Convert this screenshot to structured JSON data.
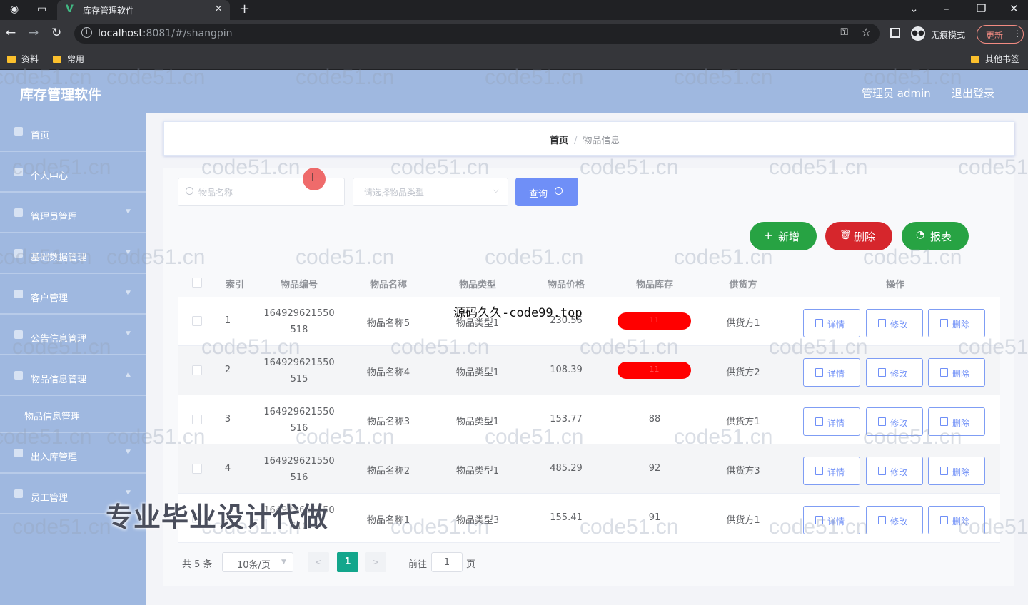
{
  "browser": {
    "tab_title": "库存管理软件",
    "url_host": "localhost",
    "url_rest": ":8081/#/shangpin",
    "incognito_label": "无痕模式",
    "update_label": "更新",
    "bookmarks": [
      "资料",
      "常用"
    ],
    "other_bookmarks": "其他书签"
  },
  "header": {
    "app_title": "库存管理软件",
    "user": "管理员 admin",
    "logout": "退出登录"
  },
  "sidebar": {
    "items": [
      "首页",
      "个人中心",
      "管理员管理",
      "基础数据管理",
      "客户管理",
      "公告信息管理",
      "物品信息管理",
      "出入库管理",
      "员工管理"
    ],
    "sub_item": "物品信息管理"
  },
  "breadcrumb": {
    "home": "首页",
    "separator": "/",
    "current": "物品信息"
  },
  "search": {
    "name_placeholder": "物品名称",
    "type_placeholder": "请选择物品类型",
    "query_label": "查询"
  },
  "actions": {
    "add": "新增",
    "delete": "删除",
    "report": "报表"
  },
  "table": {
    "headers": [
      "索引",
      "物品编号",
      "物品名称",
      "物品类型",
      "物品价格",
      "物品库存",
      "供货方",
      "操作"
    ],
    "rows": [
      {
        "index": "1",
        "code_1": "164929621550",
        "code_2": "518",
        "name": "物品名称5",
        "type": "物品类型1",
        "price": "230.56",
        "stock": "11",
        "supplier": "供货方1",
        "stock_alert": true
      },
      {
        "index": "2",
        "code_1": "164929621550",
        "code_2": "515",
        "name": "物品名称4",
        "type": "物品类型1",
        "price": "108.39",
        "stock": "11",
        "supplier": "供货方2",
        "stock_alert": true
      },
      {
        "index": "3",
        "code_1": "164929621550",
        "code_2": "516",
        "name": "物品名称3",
        "type": "物品类型1",
        "price": "153.77",
        "stock": "88",
        "supplier": "供货方1",
        "stock_alert": false
      },
      {
        "index": "4",
        "code_1": "164929621550",
        "code_2": "516",
        "name": "物品名称2",
        "type": "物品类型1",
        "price": "485.29",
        "stock": "92",
        "supplier": "供货方3",
        "stock_alert": false
      },
      {
        "index": "5",
        "code_1": "164929621550",
        "code_2": "410",
        "name": "物品名称1",
        "type": "物品类型3",
        "price": "155.41",
        "stock": "91",
        "supplier": "供货方1",
        "stock_alert": false
      }
    ],
    "op_detail": "详情",
    "op_edit": "修改",
    "op_delete": "删除"
  },
  "pagination": {
    "total": "共 5 条",
    "page_size": "10条/页",
    "current_page": "1",
    "goto_label": "前往",
    "goto_value": "1",
    "page_suffix": "页"
  },
  "overlays": {
    "watermark": "code51.cn",
    "promo": "专业毕业设计代做",
    "site": "源码久久-code99.top"
  },
  "colors": {
    "header_bg": "#9fb8e0",
    "primary": "#6f8ff7",
    "success": "#27a343",
    "danger": "#d6262c",
    "stock_alert": "#ff0000",
    "pager_active": "#13a68c"
  }
}
